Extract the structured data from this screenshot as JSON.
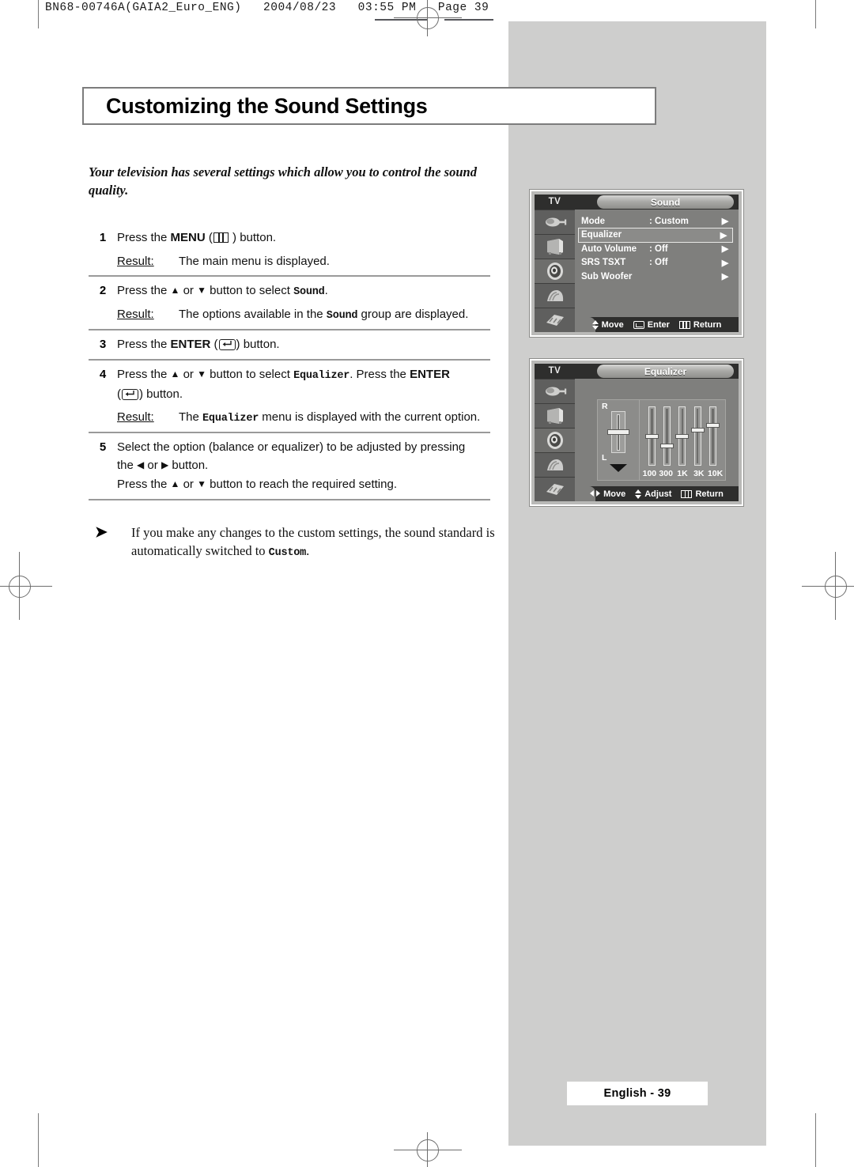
{
  "print_header": {
    "text": "BN68-00746A(GAIA2_Euro_ENG)   2004/08/23   03:55 PM   Page 39"
  },
  "title": "Customizing the Sound Settings",
  "intro": "Your television has several settings which allow you to control the sound quality.",
  "steps": [
    {
      "num": "1",
      "line1_a": "Press the ",
      "line1_bold": "MENU",
      "line1_b": " (",
      "line1_c": " ) button.",
      "result_label": "Result:",
      "result_text": "The main menu is displayed."
    },
    {
      "num": "2",
      "pre": "Press the ",
      "mid": " or ",
      "post": " button to select ",
      "target": "Sound",
      "end": ".",
      "result_label": "Result:",
      "result_pre": "The options available in the ",
      "result_target": "Sound",
      "result_post": " group are displayed."
    },
    {
      "num": "3",
      "line1_a": "Press the ",
      "line1_bold": "ENTER",
      "line1_b": " (",
      "line1_c": ") button."
    },
    {
      "num": "4",
      "pre": "Press the ",
      "mid": " or ",
      "post": " button to select ",
      "target": "Equalizer",
      "after_target": ". Press the ",
      "bold2": "ENTER",
      "line2_a": "(",
      "line2_b": ") button.",
      "result_label": "Result:",
      "result_pre": "The ",
      "result_target": "Equalizer",
      "result_post": " menu is displayed with the current option."
    },
    {
      "num": "5",
      "l1": "Select the option (balance or equalizer) to be adjusted by pressing",
      "l2_a": "the ",
      "l2_b": " or ",
      "l2_c": " button.",
      "l3_a": "Press the ",
      "l3_b": " or ",
      "l3_c": " button to reach the required setting."
    }
  ],
  "note": {
    "bullet": "➤",
    "pre": "If you make any changes to the custom settings, the sound standard is automatically switched to ",
    "target": "Custom",
    "post": "."
  },
  "osd_sound": {
    "tv_label": "TV",
    "title": "Sound",
    "rows": [
      {
        "label": "Mode",
        "value": ": Custom",
        "arrow": "▶",
        "highlighted": false
      },
      {
        "label": "Equalizer",
        "value": "",
        "arrow": "▶",
        "highlighted": true
      },
      {
        "label": "Auto Volume",
        "value": ": Off",
        "arrow": "▶",
        "highlighted": false
      },
      {
        "label": "SRS TSXT",
        "value": ": Off",
        "arrow": "▶",
        "highlighted": false
      },
      {
        "label": "Sub Woofer",
        "value": "",
        "arrow": "▶",
        "highlighted": false
      }
    ],
    "nav": [
      {
        "icon": "up-down-arrow-icon",
        "label": "Move"
      },
      {
        "icon": "enter-icon",
        "label": "Enter"
      },
      {
        "icon": "menu-icon",
        "label": "Return"
      }
    ]
  },
  "osd_equalizer": {
    "tv_label": "TV",
    "title": "Equalizer",
    "balance": {
      "top_label": "R",
      "bottom_label": "L",
      "position_pct": 50
    },
    "bands": [
      {
        "label": "100",
        "position_pct": 50
      },
      {
        "label": "300",
        "position_pct": 33
      },
      {
        "label": "1K",
        "position_pct": 50
      },
      {
        "label": "3K",
        "position_pct": 60
      },
      {
        "label": "10K",
        "position_pct": 68
      }
    ],
    "nav": [
      {
        "icon": "left-right-arrow-icon",
        "label": "Move"
      },
      {
        "icon": "up-down-arrow-icon",
        "label": "Adjust"
      },
      {
        "icon": "menu-icon",
        "label": "Return"
      }
    ]
  },
  "page_footer": "English - 39",
  "colors": {
    "gray_panel": "#cececd",
    "osd_bg": "#7f7f7d",
    "osd_dark": "#2e2e2d",
    "rule": "#9a9a9a"
  }
}
